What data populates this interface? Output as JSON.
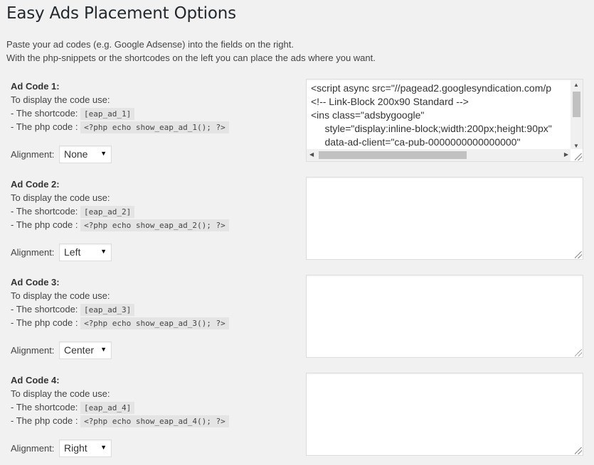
{
  "page": {
    "title": "Easy Ads Placement Options",
    "intro_line1": "Paste your ad codes (e.g. Google Adsense) into the fields on the right.",
    "intro_line2": "With the php-snippets or the shortcodes on the left you can place the ads where you want."
  },
  "labels": {
    "display_text": "To display the code use:",
    "shortcode_label": "- The shortcode:",
    "php_label": "- The php code :",
    "alignment_label": "Alignment:"
  },
  "ads": [
    {
      "heading": "Ad Code 1:",
      "shortcode": "[eap_ad_1]",
      "php": "<?php echo show_eap_ad_1(); ?>",
      "alignment": "None",
      "code_lines": [
        "<script async src=\"//pagead2.googlesyndication.com/p",
        "<!-- Link-Block 200x90 Standard -->",
        "<ins class=\"adsbygoogle\"",
        "     style=\"display:inline-block;width:200px;height:90px\"",
        "     data-ad-client=\"ca-pub-0000000000000000\""
      ]
    },
    {
      "heading": "Ad Code 2:",
      "shortcode": "[eap_ad_2]",
      "php": "<?php echo show_eap_ad_2(); ?>",
      "alignment": "Left"
    },
    {
      "heading": "Ad Code 3:",
      "shortcode": "[eap_ad_3]",
      "php": "<?php echo show_eap_ad_3(); ?>",
      "alignment": "Center"
    },
    {
      "heading": "Ad Code 4:",
      "shortcode": "[eap_ad_4]",
      "php": "<?php echo show_eap_ad_4(); ?>",
      "alignment": "Right"
    }
  ],
  "icons": {
    "select_arrow": "chevron-down-icon",
    "resize": "resize-grip-icon"
  }
}
